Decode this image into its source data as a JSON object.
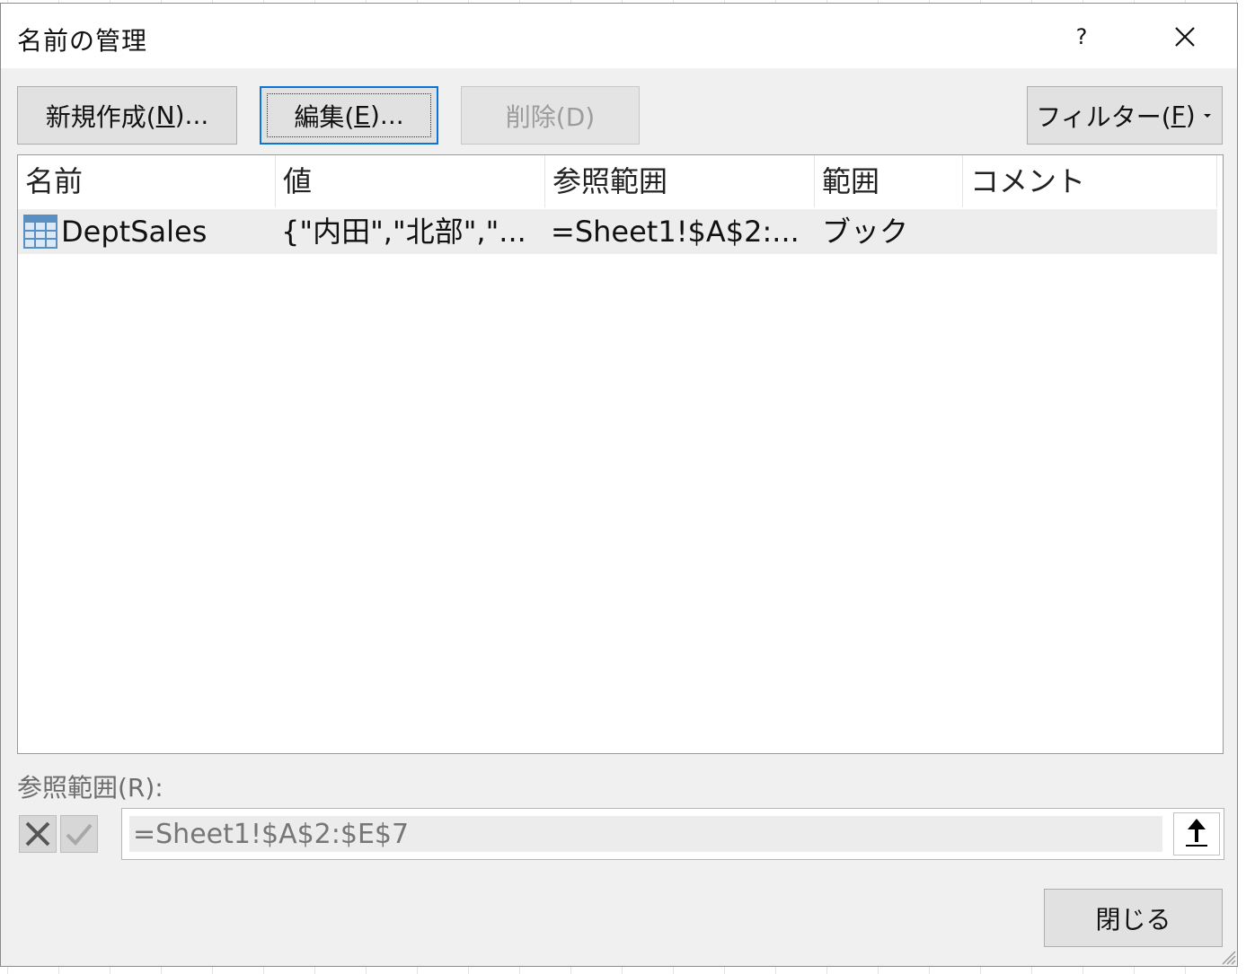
{
  "dialog": {
    "title": "名前の管理",
    "help_label": "?"
  },
  "toolbar": {
    "new_label": "新規作成(",
    "new_mnemonic": "N",
    "new_suffix": ")...",
    "edit_label": "編集(",
    "edit_mnemonic": "E",
    "edit_suffix": ")...",
    "delete_label": "削除(D)",
    "filter_label": "フィルター(",
    "filter_mnemonic": "F",
    "filter_suffix": ")"
  },
  "list": {
    "columns": [
      "名前",
      "値",
      "参照範囲",
      "範囲",
      "コメント"
    ],
    "rows": [
      {
        "icon": "table-icon",
        "name": "DeptSales",
        "value": "{\"内田\",\"北部\",\"...",
        "refers_to": "=Sheet1!$A$2:...",
        "scope": "ブック",
        "comment": ""
      }
    ]
  },
  "refers": {
    "label": "参照範囲(R):",
    "value": "=Sheet1!$A$2:$E$7"
  },
  "footer": {
    "close_label": "閉じる"
  },
  "colors": {
    "focus": "#0b74d6",
    "table_icon": "#5a8fc4"
  }
}
